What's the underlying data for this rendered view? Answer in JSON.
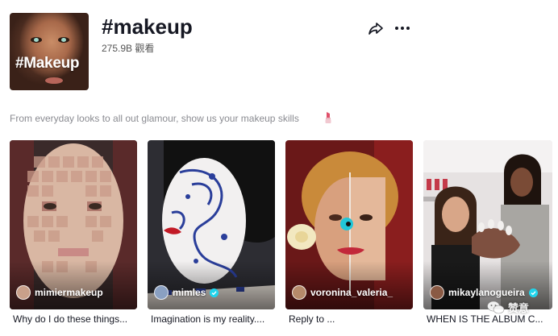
{
  "header": {
    "cover_text": "#Makeup",
    "title": "#makeup",
    "views": "275.9B 觀看"
  },
  "description": "From everyday looks to all out glamour, show us your makeup skills",
  "videos": [
    {
      "author": "mimiermakeup",
      "verified": false,
      "caption": "Why do I do these things..."
    },
    {
      "author": "mimles",
      "verified": true,
      "caption": "Imagination is my reality...."
    },
    {
      "author": "voronina_valeria_",
      "verified": false,
      "caption": "Reply to ..."
    },
    {
      "author": "mikaylanogueira",
      "verified": true,
      "caption": "WHEN IS THE ALBUM C..."
    }
  ],
  "watermark": "赞意",
  "icons": [
    "share-icon",
    "more-icon",
    "lipstick-icon",
    "verified-icon",
    "wechat-icon"
  ],
  "colors": {
    "text": "#161823",
    "muted": "#8a8b91",
    "verified": "#20d5ec"
  }
}
